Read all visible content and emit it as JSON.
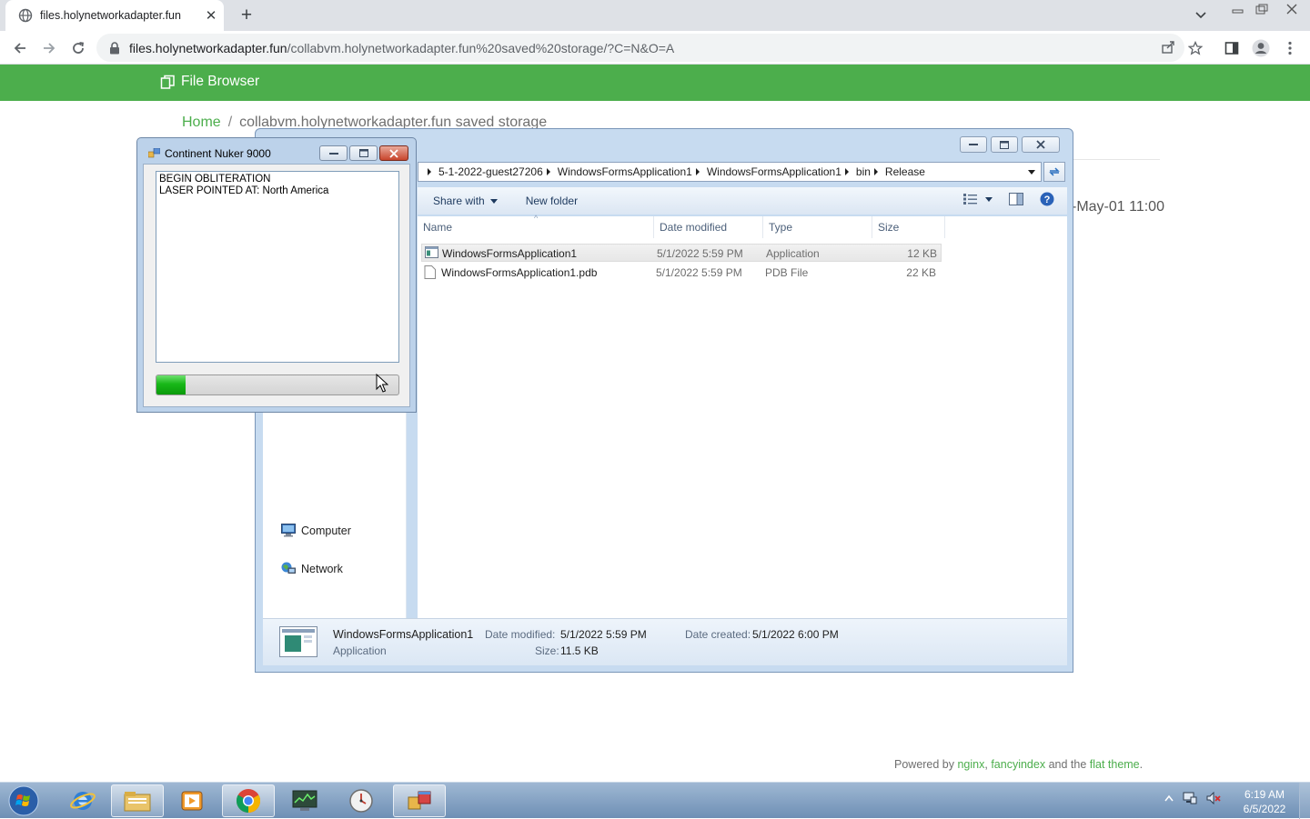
{
  "browser": {
    "tab_title": "files.holynetworkadapter.fun",
    "url_host": "files.holynetworkadapter.fun",
    "url_path": "/collabvm.holynetworkadapter.fun%20saved%20storage/?C=N&O=A"
  },
  "page": {
    "brand": "File Browser",
    "breadcrumb_home": "Home",
    "breadcrumb_sep": "/",
    "breadcrumb_current": "collabvm.holynetworkadapter.fun saved storage",
    "date_fragment": "-May-01 11:00",
    "col_fragment": "l",
    "footer_prefix": "Powered by ",
    "footer_nginx": "nginx",
    "footer_comma": ", ",
    "footer_fancyindex": "fancyindex",
    "footer_and": " and the ",
    "footer_theme": "flat theme",
    "footer_period": "."
  },
  "explorer": {
    "path": [
      "5-1-2022-guest27206",
      "WindowsFormsApplication1",
      "WindowsFormsApplication1",
      "bin",
      "Release"
    ],
    "share_with": "Share with",
    "new_folder": "New folder",
    "columns": {
      "name": "Name",
      "date": "Date modified",
      "type": "Type",
      "size": "Size"
    },
    "files": [
      {
        "name": "WindowsFormsApplication1",
        "date": "5/1/2022 5:59 PM",
        "type": "Application",
        "size": "12 KB"
      },
      {
        "name": "WindowsFormsApplication1.pdb",
        "date": "5/1/2022 5:59 PM",
        "type": "PDB File",
        "size": "22 KB"
      }
    ],
    "nav": {
      "computer": "Computer",
      "network": "Network"
    },
    "details": {
      "name": "WindowsFormsApplication1",
      "kind": "Application",
      "modified_label": "Date modified:",
      "modified_value": "5/1/2022 5:59 PM",
      "size_label": "Size:",
      "size_value": "11.5 KB",
      "created_label": "Date created:",
      "created_value": "5/1/2022 6:00 PM"
    }
  },
  "nuker": {
    "title": "Continent Nuker 9000",
    "log": "BEGIN OBLITERATION\nLASER POINTED AT: North America",
    "progress": 0.12
  },
  "taskbar": {
    "time": "6:19 AM",
    "date": "6/5/2022"
  },
  "colors": {
    "accent_green": "#4cae4c",
    "progress_green": "#18b818"
  }
}
